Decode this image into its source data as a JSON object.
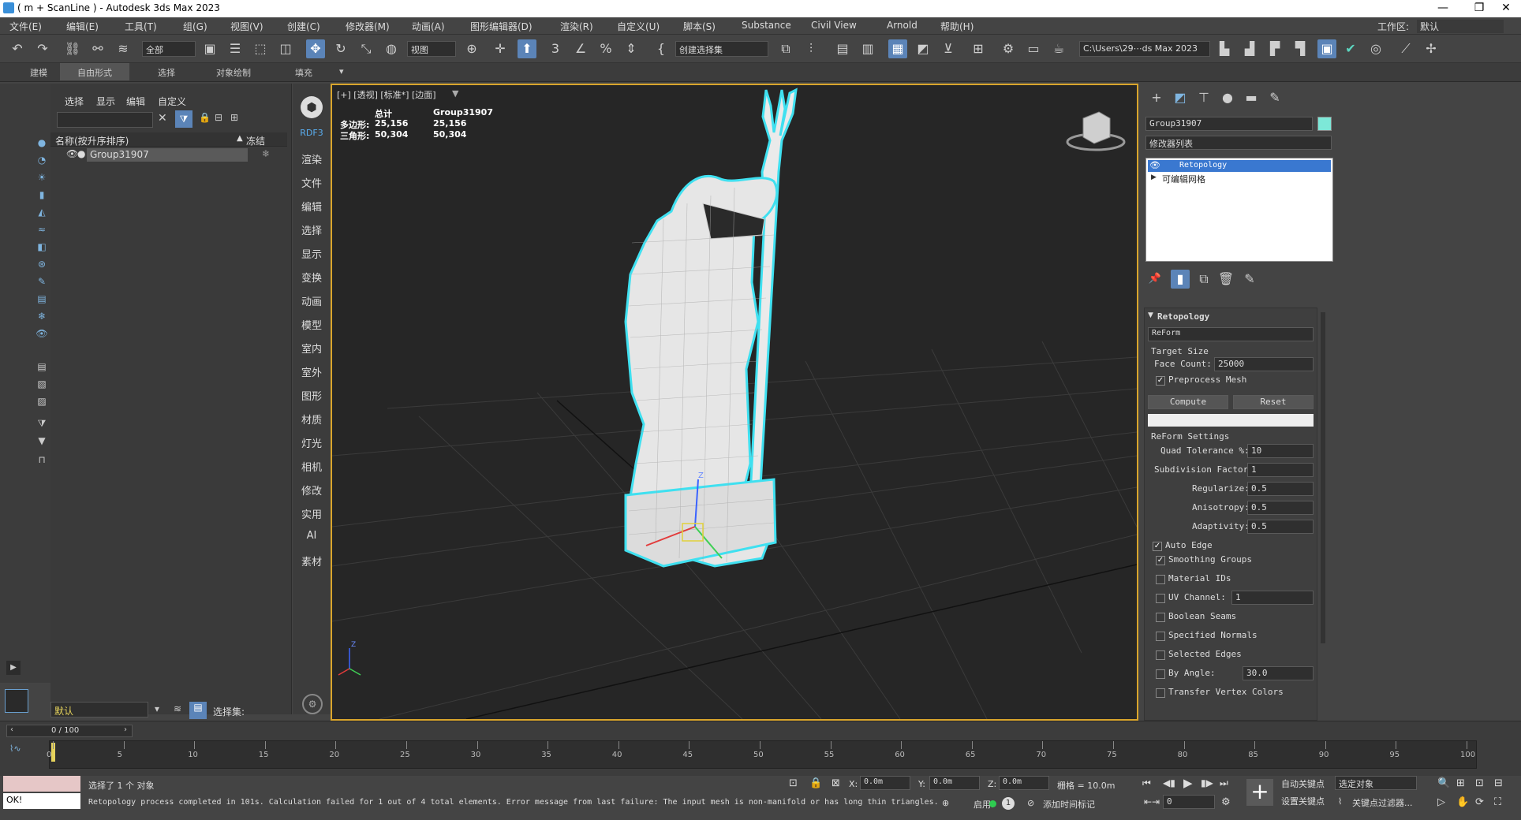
{
  "window": {
    "title": "( m + ScanLine ) - Autodesk 3ds Max 2023",
    "minimize": "—",
    "maximize": "❐",
    "close": "✕"
  },
  "menubar": {
    "items": [
      "文件(E)",
      "编辑(E)",
      "工具(T)",
      "组(G)",
      "视图(V)",
      "创建(C)",
      "修改器(M)",
      "动画(A)",
      "图形编辑器(D)",
      "渲染(R)",
      "自定义(U)",
      "脚本(S)",
      "Substance",
      "Civil View",
      "Arnold",
      "帮助(H)"
    ],
    "workspace_label": "工作区:",
    "workspace_value": "默认"
  },
  "toolbar": {
    "selection_filter": "全部",
    "view_dropdown": "视图",
    "named_set": "创建选择集",
    "path": "C:\\Users\\29⋯ds Max 2023"
  },
  "ribbon": {
    "tabs": [
      "建模",
      "自由形式",
      "选择",
      "对象绘制",
      "填充"
    ]
  },
  "scene_explorer": {
    "menu": [
      "选择",
      "显示",
      "编辑",
      "自定义"
    ],
    "col_name": "名称(按升序排序)",
    "col_freeze": "冻结",
    "row_name": "Group31907",
    "layer": "默认",
    "selection_set_label": "选择集:"
  },
  "command_strip": {
    "items": [
      "RDF3",
      "渲染",
      "文件",
      "编辑",
      "选择",
      "显示",
      "变换",
      "动画",
      "模型",
      "室内",
      "室外",
      "图形",
      "材质",
      "灯光",
      "相机",
      "修改",
      "实用",
      "AI",
      "素材"
    ]
  },
  "viewport": {
    "label": "[+] [透视] [标准*] [边面]",
    "stats_total": "总计",
    "stats_obj": "Group31907",
    "poly_label": "多边形:",
    "poly_total": "25,156",
    "poly_obj": "25,156",
    "tri_label": "三角形:",
    "tri_total": "50,304",
    "tri_obj": "50,304",
    "gizmo_z": "Z",
    "axis_z": "Z",
    "accent": "#3fe0f0",
    "frame_color": "#d9a52c"
  },
  "modify_panel": {
    "object_name": "Group31907",
    "object_color": "#7de8d8",
    "modifier_list": "修改器列表",
    "stack": [
      "Retopology",
      "可编辑网格"
    ],
    "rollout_title": "Retopology",
    "mode": "ReForm",
    "target_size": "Target Size",
    "face_count_label": "Face Count:",
    "face_count": "25000",
    "preprocess": "Preprocess Mesh",
    "compute": "Compute",
    "reset": "Reset",
    "reform_settings": "ReForm Settings",
    "params": [
      {
        "label": "Quad Tolerance %:",
        "value": "10"
      },
      {
        "label": "Subdivision Factor:",
        "value": "1"
      },
      {
        "label": "Regularize:",
        "value": "0.5"
      },
      {
        "label": "Anisotropy:",
        "value": "0.5"
      },
      {
        "label": "Adaptivity:",
        "value": "0.5"
      }
    ],
    "auto_edge": "Auto Edge",
    "smoothing_groups": "Smoothing Groups",
    "material_ids": "Material IDs",
    "uv_channel": "UV Channel:",
    "uv_channel_value": "1",
    "boolean_seams": "Boolean Seams",
    "specified_normals": "Specified Normals",
    "selected_edges": "Selected Edges",
    "by_angle": "By Angle:",
    "by_angle_value": "30.0",
    "transfer_vertex_colors": "Transfer Vertex Colors"
  },
  "timeline": {
    "frame": "0 / 100",
    "ticks": [
      "0",
      "5",
      "10",
      "15",
      "20",
      "25",
      "30",
      "35",
      "40",
      "45",
      "50",
      "55",
      "60",
      "65",
      "70",
      "75",
      "80",
      "85",
      "90",
      "95",
      "100"
    ]
  },
  "status": {
    "selected": "选择了 1 个 对象",
    "prompt": "Retopology process completed in 101s. Calculation failed for 1 out of 4 total elements. Error message from last failure: The input mesh is non-manifold or has long thin triangles.",
    "listener": "OK!",
    "x_label": "X:",
    "x": "0.0m",
    "y_label": "Y:",
    "y": "0.0m",
    "z_label": "Z:",
    "z": "0.0m",
    "grid": "栅格 = 10.0m",
    "enable": "启用:",
    "add_time_tag": "添加时间标记",
    "auto_key": "自动关键点",
    "set_key": "设置关键点",
    "key_target": "选定对象",
    "key_filters": "关键点过滤器...",
    "frame_spinner": "0"
  }
}
